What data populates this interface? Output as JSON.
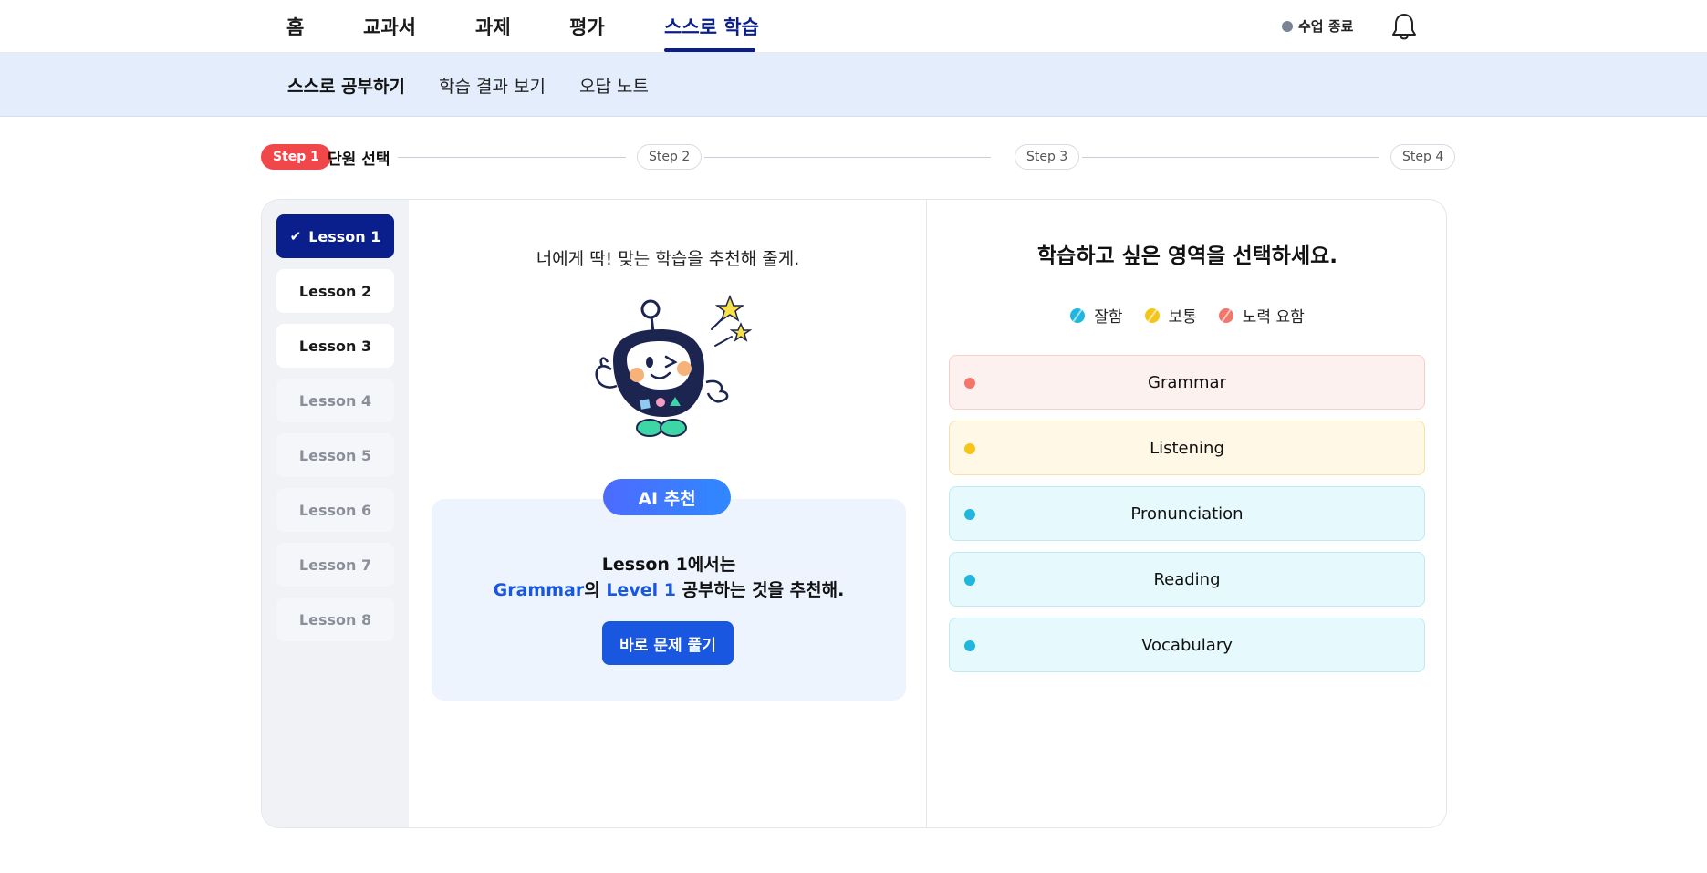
{
  "topnav": {
    "items": [
      "홈",
      "교과서",
      "과제",
      "평가",
      "스스로 학습"
    ],
    "active_index": 4,
    "end_class_label": "수업 종료"
  },
  "subnav": {
    "items": [
      "스스로 공부하기",
      "학습 결과 보기",
      "오답 노트"
    ],
    "active_index": 0
  },
  "steps": {
    "items": [
      "Step 1",
      "Step 2",
      "Step 3",
      "Step 4"
    ],
    "current_label": "단원 선택",
    "active_index": 0
  },
  "lessons": {
    "items": [
      {
        "label": "Lesson 1",
        "state": "selected"
      },
      {
        "label": "Lesson 2",
        "state": "enabled"
      },
      {
        "label": "Lesson 3",
        "state": "enabled"
      },
      {
        "label": "Lesson 4",
        "state": "disabled"
      },
      {
        "label": "Lesson 5",
        "state": "disabled"
      },
      {
        "label": "Lesson 6",
        "state": "disabled"
      },
      {
        "label": "Lesson 7",
        "state": "disabled"
      },
      {
        "label": "Lesson 8",
        "state": "disabled"
      }
    ]
  },
  "recommend": {
    "intro": "너에게 딱! 맞는 학습을 추천해 줄게.",
    "badge": "AI 추천",
    "line1": "Lesson 1에서는",
    "line2_area": "Grammar",
    "line2_mid": "의 ",
    "line2_level": "Level 1",
    "line2_end": " 공부하는 것을 추천해.",
    "button": "바로 문제 풀기"
  },
  "areas": {
    "title": "학습하고 싶은 영역을 선택하세요.",
    "legend": [
      {
        "label": "잘함",
        "color": "#1fb6e0"
      },
      {
        "label": "보통",
        "color": "#f5c518"
      },
      {
        "label": "노력 요함",
        "color": "#f2766a"
      }
    ],
    "items": [
      {
        "label": "Grammar",
        "level": "노력 요함",
        "bg": "#fdf1f0",
        "border": "#f6cfcb",
        "dot": "#f2766a"
      },
      {
        "label": "Listening",
        "level": "보통",
        "bg": "#fff8e6",
        "border": "#f6e1a6",
        "dot": "#f5c518"
      },
      {
        "label": "Pronunciation",
        "level": "잘함",
        "bg": "#e6f9fc",
        "border": "#bfeaf2",
        "dot": "#1fb6e0"
      },
      {
        "label": "Reading",
        "level": "잘함",
        "bg": "#e6f9fc",
        "border": "#bfeaf2",
        "dot": "#1fb6e0"
      },
      {
        "label": "Vocabulary",
        "level": "잘함",
        "bg": "#e6f9fc",
        "border": "#bfeaf2",
        "dot": "#1fb6e0"
      }
    ]
  },
  "colors": {
    "primary": "#0a1e8c",
    "accent_blue": "#1a57e0",
    "step_active": "#f0474a"
  }
}
